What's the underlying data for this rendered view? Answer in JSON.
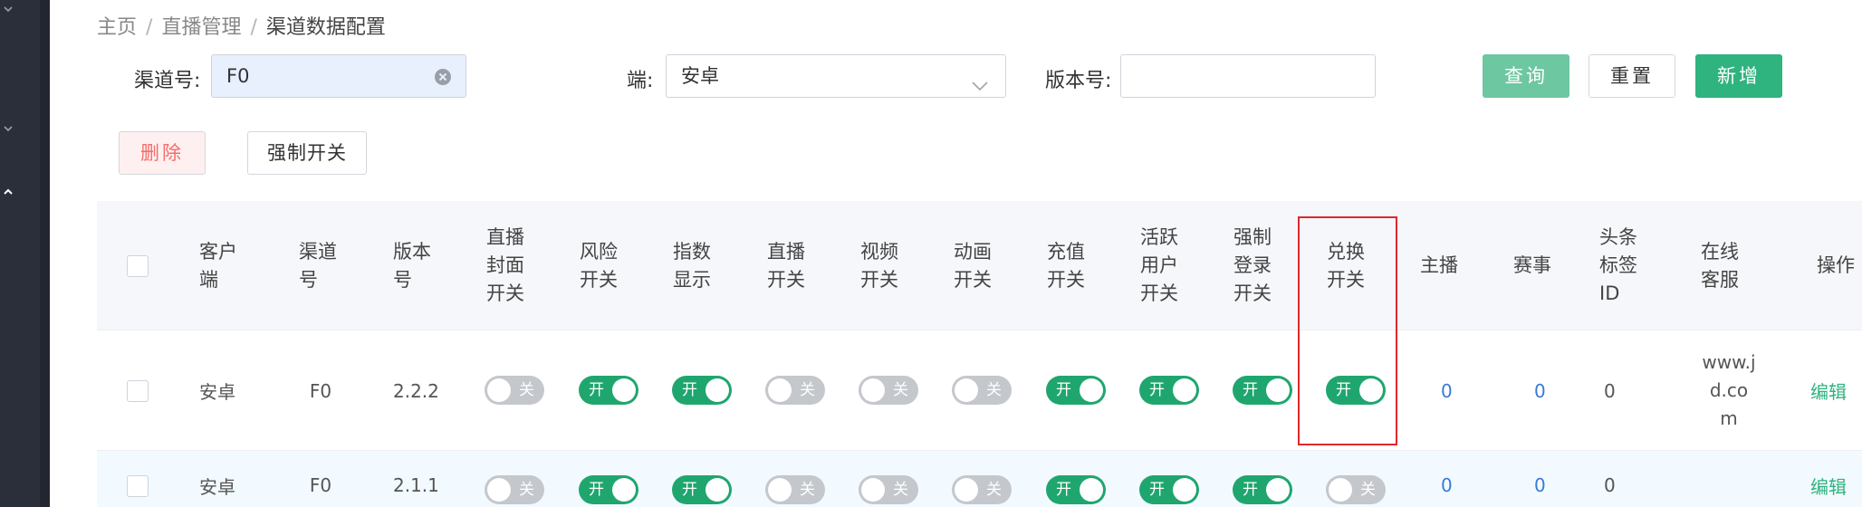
{
  "breadcrumb": {
    "home": "主页",
    "live": "直播管理",
    "current": "渠道数据配置",
    "separator": "/"
  },
  "filters": {
    "channel_label": "渠道号:",
    "channel_value": "F0",
    "platform_label": "端:",
    "platform_value": "安卓",
    "version_label": "版本号:",
    "version_value": ""
  },
  "buttons": {
    "query": "查询",
    "reset": "重置",
    "add": "新增",
    "delete": "删除",
    "force_switch": "强制开关"
  },
  "table": {
    "headers": {
      "client": [
        "客户",
        "端"
      ],
      "channel": [
        "渠道",
        "号"
      ],
      "version": [
        "版本",
        "号"
      ],
      "live_cover": [
        "直播",
        "封面",
        "开关"
      ],
      "risk": [
        "风险",
        "开关"
      ],
      "index_display": [
        "指数",
        "显示"
      ],
      "live": [
        "直播",
        "开关"
      ],
      "video": [
        "视频",
        "开关"
      ],
      "animation": [
        "动画",
        "开关"
      ],
      "recharge": [
        "充值",
        "开关"
      ],
      "active_user": [
        "活跃",
        "用户",
        "开关"
      ],
      "force_login": [
        "强制",
        "登录",
        "开关"
      ],
      "exchange": [
        "兑换",
        "开关"
      ],
      "anchor": "主播",
      "event": "赛事",
      "headline_tag": [
        "头条",
        "标签",
        "ID"
      ],
      "online_service": [
        "在线",
        "客服"
      ],
      "actions": "操作"
    },
    "switch_on_label": "开",
    "switch_off_label": "关",
    "rows": [
      {
        "client": "安卓",
        "channel": "F0",
        "version": "2.2.2",
        "switches": [
          false,
          true,
          true,
          false,
          false,
          false,
          true,
          true,
          true,
          true
        ],
        "anchor": "0",
        "event": "0",
        "headline_tag_id": "0",
        "online_service": [
          "www.j",
          "d.co",
          "m"
        ],
        "edit": "编辑"
      },
      {
        "client": "安卓",
        "channel": "F0",
        "version": "2.1.1",
        "switches": [
          false,
          true,
          true,
          false,
          false,
          false,
          true,
          true,
          true,
          false
        ],
        "anchor": "0",
        "event": "0",
        "headline_tag_id": "0",
        "online_service": [],
        "edit": "编辑"
      }
    ]
  },
  "colors": {
    "primary_green": "#2fb37f",
    "switch_on": "#1fa66e",
    "switch_off": "#c4c7cc",
    "link_blue": "#3a7bd5",
    "highlight_red": "#e0282e"
  }
}
